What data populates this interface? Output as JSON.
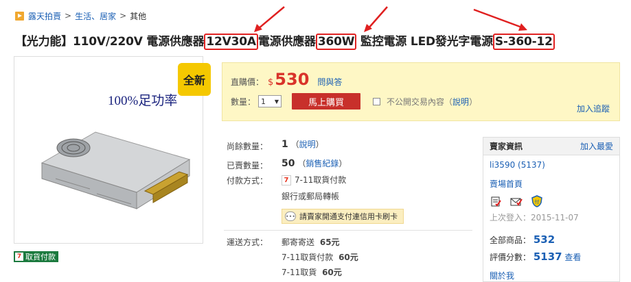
{
  "breadcrumb": {
    "items": [
      "露天拍賣",
      "生活、居家",
      "其他"
    ],
    "separator": ">"
  },
  "title": {
    "part1": "【光力能】110V/220V 電源供應器",
    "hl1": "12V30A",
    "part2": "電源供應器",
    "hl2": "360W",
    "part3": " 監控電源 LED發光字電源",
    "hl3": "S-360-12"
  },
  "product_image": {
    "overlay_text": "100%足功率"
  },
  "badge_new": "全新",
  "cod_badge": "取貨付款",
  "buy": {
    "price_label": "直購價：",
    "currency": "$",
    "price": "530",
    "ask_link": "問與答",
    "qty_label": "數量：",
    "qty_value": "1",
    "buy_button": "馬上購買",
    "private_label": "不公開交易內容",
    "private_help": "說明",
    "track": "加入追蹤"
  },
  "details": {
    "remaining_label": "尚餘數量：",
    "remaining_value": "1",
    "remaining_help": "說明",
    "sold_label": "已賣數量：",
    "sold_value": "50",
    "sold_help": "銷售紀錄",
    "payment_label": "付款方式：",
    "payment_711": "7-11取貨付款",
    "payment_bank": "銀行或郵局轉帳",
    "notice": "請賣家開通支付連信用卡刷卡",
    "shipping_label": "運送方式：",
    "ship_post": "郵寄寄送",
    "ship_post_price": "65元",
    "ship_711cod": "7-11取貨付款",
    "ship_711cod_price": "60元",
    "ship_711": "7-11取貨",
    "ship_711_price": "60元"
  },
  "seller": {
    "title": "賣家資訊",
    "add_fav": "加入最愛",
    "name": "li3590",
    "score": "(5137)",
    "store_home": "賣場首頁",
    "last_login_label": "上次登入：",
    "last_login": "2015-11-07",
    "all_items_label": "全部商品：",
    "all_items": "532",
    "rating_label": "評價分數：",
    "rating": "5137",
    "rating_view": "查看",
    "about": "關於我"
  },
  "colors": {
    "highlight": "#e02020",
    "price": "#d9332a",
    "link": "#1a5fb4",
    "buy_box_bg": "#fef7c5",
    "new_badge": "#f5c800"
  }
}
